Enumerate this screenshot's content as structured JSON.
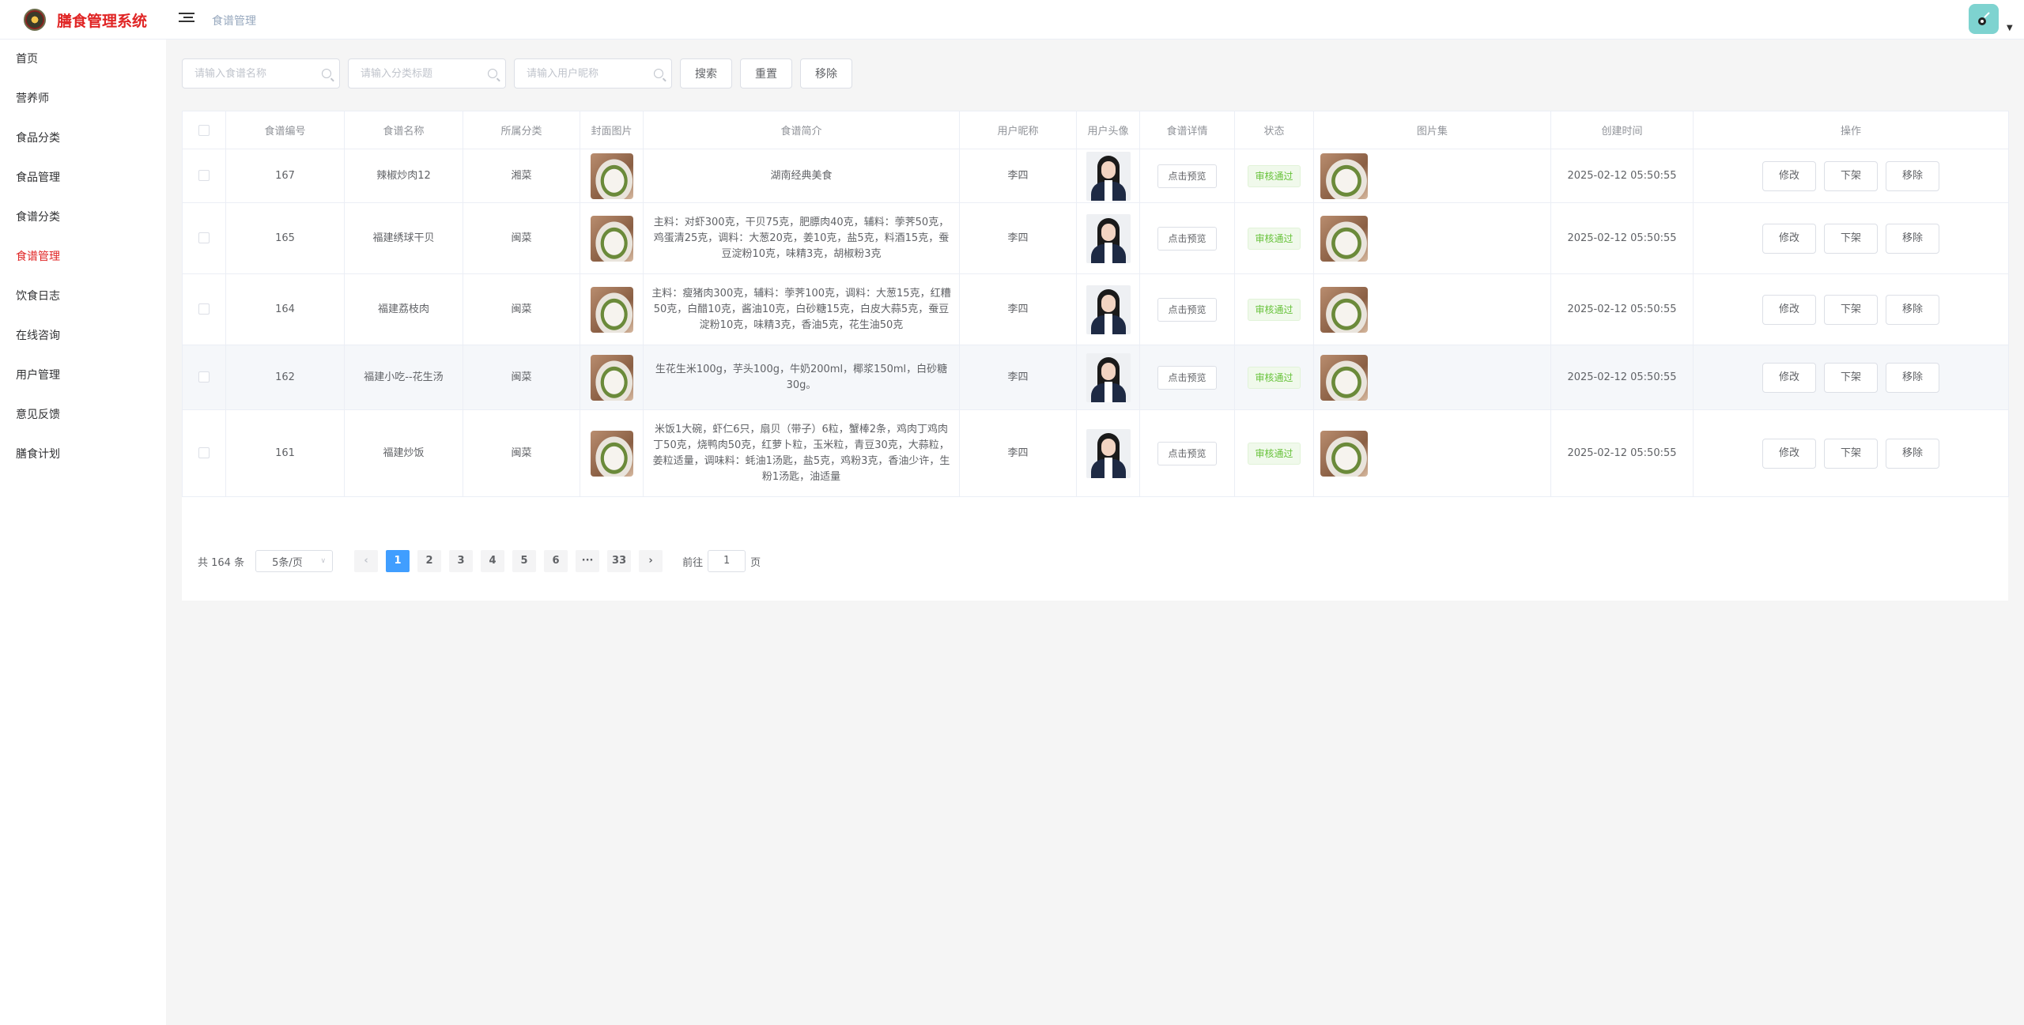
{
  "header": {
    "app_title": "膳食管理系统",
    "breadcrumb": "食谱管理"
  },
  "sidebar": {
    "items": [
      {
        "label": "首页"
      },
      {
        "label": "营养师"
      },
      {
        "label": "食品分类"
      },
      {
        "label": "食品管理"
      },
      {
        "label": "食谱分类"
      },
      {
        "label": "食谱管理"
      },
      {
        "label": "饮食日志"
      },
      {
        "label": "在线咨询"
      },
      {
        "label": "用户管理"
      },
      {
        "label": "意见反馈"
      },
      {
        "label": "膳食计划"
      }
    ],
    "active": "食谱管理"
  },
  "search": {
    "name_placeholder": "请输入食谱名称",
    "category_placeholder": "请输入分类标题",
    "user_placeholder": "请输入用户昵称",
    "search_label": "搜索",
    "reset_label": "重置",
    "remove_label": "移除"
  },
  "table": {
    "columns": [
      "食谱编号",
      "食谱名称",
      "所属分类",
      "封面图片",
      "食谱简介",
      "用户昵称",
      "用户头像",
      "食谱详情",
      "状态",
      "图片集",
      "创建时间",
      "操作"
    ],
    "preview_label": "点击预览",
    "status_label": "审核通过",
    "actions": [
      "修改",
      "下架",
      "移除"
    ],
    "rows": [
      {
        "id": "167",
        "name": "辣椒炒肉12",
        "category": "湘菜",
        "intro": "湖南经典美食",
        "user": "李四",
        "created": "2025-02-12 05:50:55"
      },
      {
        "id": "165",
        "name": "福建绣球干贝",
        "category": "闽菜",
        "intro": "主料：对虾300克，干贝75克，肥膘肉40克，辅料：荸荠50克，鸡蛋清25克，调料：大葱20克，姜10克，盐5克，料酒15克，蚕豆淀粉10克，味精3克，胡椒粉3克",
        "user": "李四",
        "created": "2025-02-12 05:50:55"
      },
      {
        "id": "164",
        "name": "福建荔枝肉",
        "category": "闽菜",
        "intro": "主料：瘦猪肉300克，辅料：荸荠100克，调料：大葱15克，红糟50克，白醋10克，酱油10克，白砂糖15克，白皮大蒜5克，蚕豆淀粉10克，味精3克，香油5克，花生油50克",
        "user": "李四",
        "created": "2025-02-12 05:50:55"
      },
      {
        "id": "162",
        "name": "福建小吃--花生汤",
        "category": "闽菜",
        "intro": "生花生米100g，芋头100g，牛奶200ml，椰浆150ml，白砂糖30g。",
        "user": "李四",
        "created": "2025-02-12 05:50:55"
      },
      {
        "id": "161",
        "name": "福建炒饭",
        "category": "闽菜",
        "intro": "米饭1大碗，虾仁6只，扇贝（带子）6粒，蟹棒2条，鸡肉丁鸡肉丁50克，烧鸭肉50克，红萝卜粒，玉米粒，青豆30克，大蒜粒，姜粒适量，调味料：蚝油1汤匙，盐5克，鸡粉3克，香油少许，生粉1汤匙，油适量",
        "user": "李四",
        "created": "2025-02-12 05:50:55"
      }
    ]
  },
  "pagination": {
    "total_text": "共 164 条",
    "page_size": "5条/页",
    "pages": [
      "1",
      "2",
      "3",
      "4",
      "5",
      "6",
      "···",
      "33"
    ],
    "current": "1",
    "goto_prefix": "前往",
    "goto_value": "1",
    "goto_suffix": "页",
    "prev": "‹",
    "next": "›"
  }
}
